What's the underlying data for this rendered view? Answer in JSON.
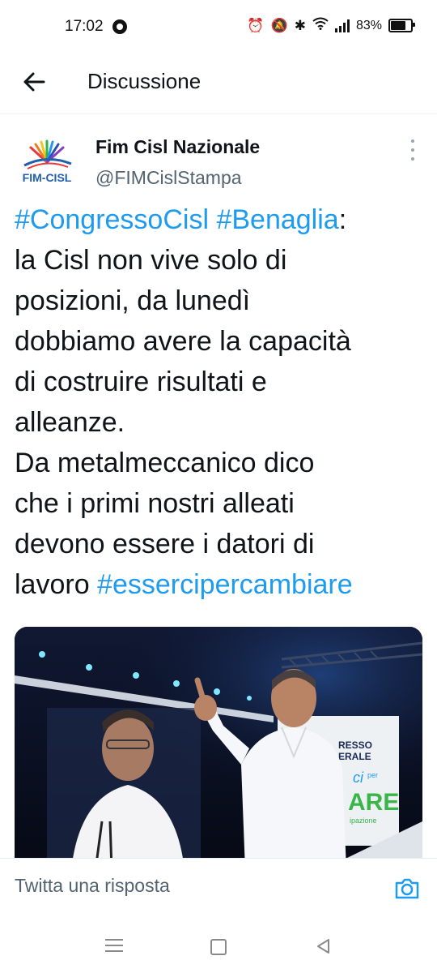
{
  "status_bar": {
    "time": "17:02",
    "battery_percent": "83%",
    "battery_level": 0.83,
    "icons": [
      "alarm-icon",
      "mute-icon",
      "bluetooth-icon",
      "wifi-icon",
      "signal-icon",
      "battery-icon"
    ]
  },
  "header": {
    "title": "Discussione",
    "back_icon": "arrow-left-icon"
  },
  "tweet": {
    "author_name": "Fim Cisl Nazionale",
    "author_handle": "@FIMCislStampa",
    "avatar_text": "FIM-CISL",
    "more_icon": "more-vertical-icon",
    "hashtag_congresso": "#CongressoCisl",
    "hashtag_benaglia": "#Benaglia",
    "line1_suffix": ":",
    "line2": "la Cisl non vive solo di",
    "line3": "posizioni, da lunedì",
    "line4": "dobbiamo avere la capacità",
    "line5": "di costruire risultati e",
    "line6": "alleanze.",
    "line7": "Da metalmeccanico dico",
    "line8": "che i primi nostri alleati",
    "line9": "devono essere i datori di",
    "line10_prefix": "lavoro",
    "hashtag_esserci": "#essercipercambiare",
    "media": {
      "screen_line1": "RESSO",
      "screen_line2": "ERALE",
      "screen_logo_small": "ci",
      "screen_logo_tiny": "per",
      "screen_logo_big": "ARE",
      "screen_caption": "ipazione"
    }
  },
  "reply_bar": {
    "placeholder": "Twitta una risposta",
    "camera_icon": "camera-icon"
  },
  "nav_bar": {
    "icons": [
      "menu-icon",
      "home-icon",
      "back-triangle-icon"
    ]
  },
  "colors": {
    "accent": "#1d9bf0",
    "text": "#0f1419",
    "secondary_text": "#536471"
  }
}
